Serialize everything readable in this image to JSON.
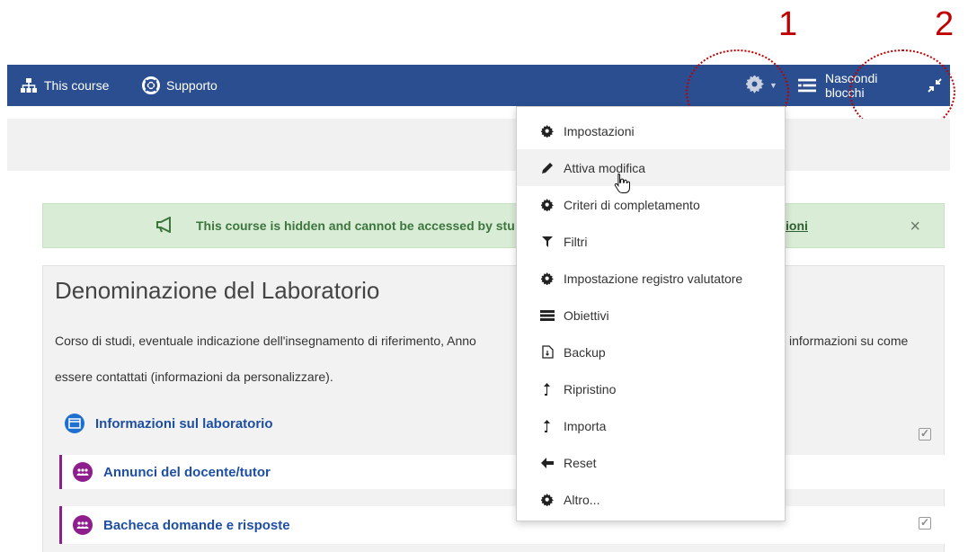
{
  "annotations": {
    "one": "1",
    "two": "2"
  },
  "navbar": {
    "course_label": "This course",
    "support_label": "Supporto",
    "hide_blocks_label": "Nascondi blocchi"
  },
  "alert": {
    "text": "This course is hidden and cannot be accessed by stu",
    "link_text": "ioni",
    "close": "×"
  },
  "course": {
    "title": "Denominazione del Laboratorio",
    "desc_line1": "Corso di studi, eventuale indicazione dell'insegnamento di riferimento, Anno",
    "desc_right": "informazioni su come",
    "desc_line2": "essere contattati (informazioni da personalizzare).",
    "activities": [
      {
        "label": "Informazioni sul laboratorio"
      },
      {
        "label": "Annunci del docente/tutor"
      },
      {
        "label": "Bacheca domande e risposte"
      }
    ]
  },
  "menu": {
    "items": [
      {
        "label": "Impostazioni",
        "icon": "gear-icon"
      },
      {
        "label": "Attiva modifica",
        "icon": "pencil-icon"
      },
      {
        "label": "Criteri di completamento",
        "icon": "gear-icon"
      },
      {
        "label": "Filtri",
        "icon": "filter-icon"
      },
      {
        "label": "Impostazione registro valutatore",
        "icon": "gear-icon"
      },
      {
        "label": "Obiettivi",
        "icon": "list-icon"
      },
      {
        "label": "Backup",
        "icon": "file-icon"
      },
      {
        "label": "Ripristino",
        "icon": "level-up-icon"
      },
      {
        "label": "Importa",
        "icon": "level-up-icon"
      },
      {
        "label": "Reset",
        "icon": "arrow-left-icon"
      },
      {
        "label": "Altro...",
        "icon": "gear-icon"
      }
    ]
  },
  "colors": {
    "navbar": "#2a4e8f",
    "annotation": "#c00000",
    "alert_bg": "#d9ecd6",
    "link": "#1e4fa2",
    "forum_icon": "#8e1d8e"
  }
}
